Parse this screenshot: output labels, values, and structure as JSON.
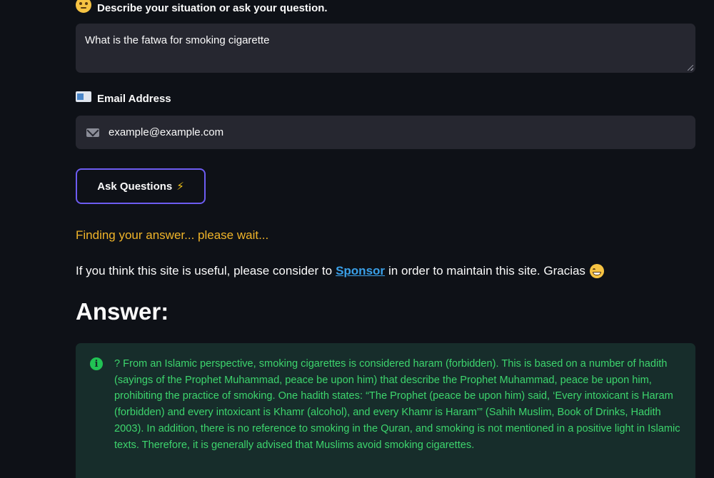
{
  "question": {
    "label": "Describe your situation or ask your question.",
    "label_icon": "thinking-face-emoji",
    "value": "What is the fatwa for smoking cigarette"
  },
  "email": {
    "label": "Email Address",
    "label_icon": "envelope-emoji",
    "value": "example@example.com",
    "field_icon": "envelope-icon"
  },
  "ask_button": {
    "label": "Ask Questions",
    "icon": "⚡",
    "border_color": "#6d5cf2"
  },
  "status_text": "Finding your answer... please wait...",
  "sponsor": {
    "prefix": "If you think this site is useful, please consider to",
    "link": "Sponsor",
    "suffix": "in order to maintain this site. Gracias",
    "emoji": "grinning-face-emoji"
  },
  "answer": {
    "heading": "Answer:",
    "icon": "info-icon",
    "text": "? From an Islamic perspective, smoking cigarettes is considered haram (forbidden). This is based on a number of hadith (sayings of the Prophet Muhammad, peace be upon him) that describe the Prophet Muhammad, peace be upon him, prohibiting the practice of smoking. One hadith states: “The Prophet (peace be upon him) said, ‘Every intoxicant is Haram (forbidden) and every intoxicant is Khamr (alcohol), and every Khamr is Haram’” (Sahih Muslim, Book of Drinks, Hadith 2003). In addition, there is no reference to smoking in the Quran, and smoking is not mentioned in a positive light in Islamic texts. Therefore, it is generally advised that Muslims avoid smoking cigarettes."
  },
  "colors": {
    "background": "#0e1117",
    "input_background": "#262730",
    "status": "#f0b429",
    "link": "#3aa0e8",
    "answer_background": "#172d2b",
    "answer_text": "#3dd56d"
  }
}
